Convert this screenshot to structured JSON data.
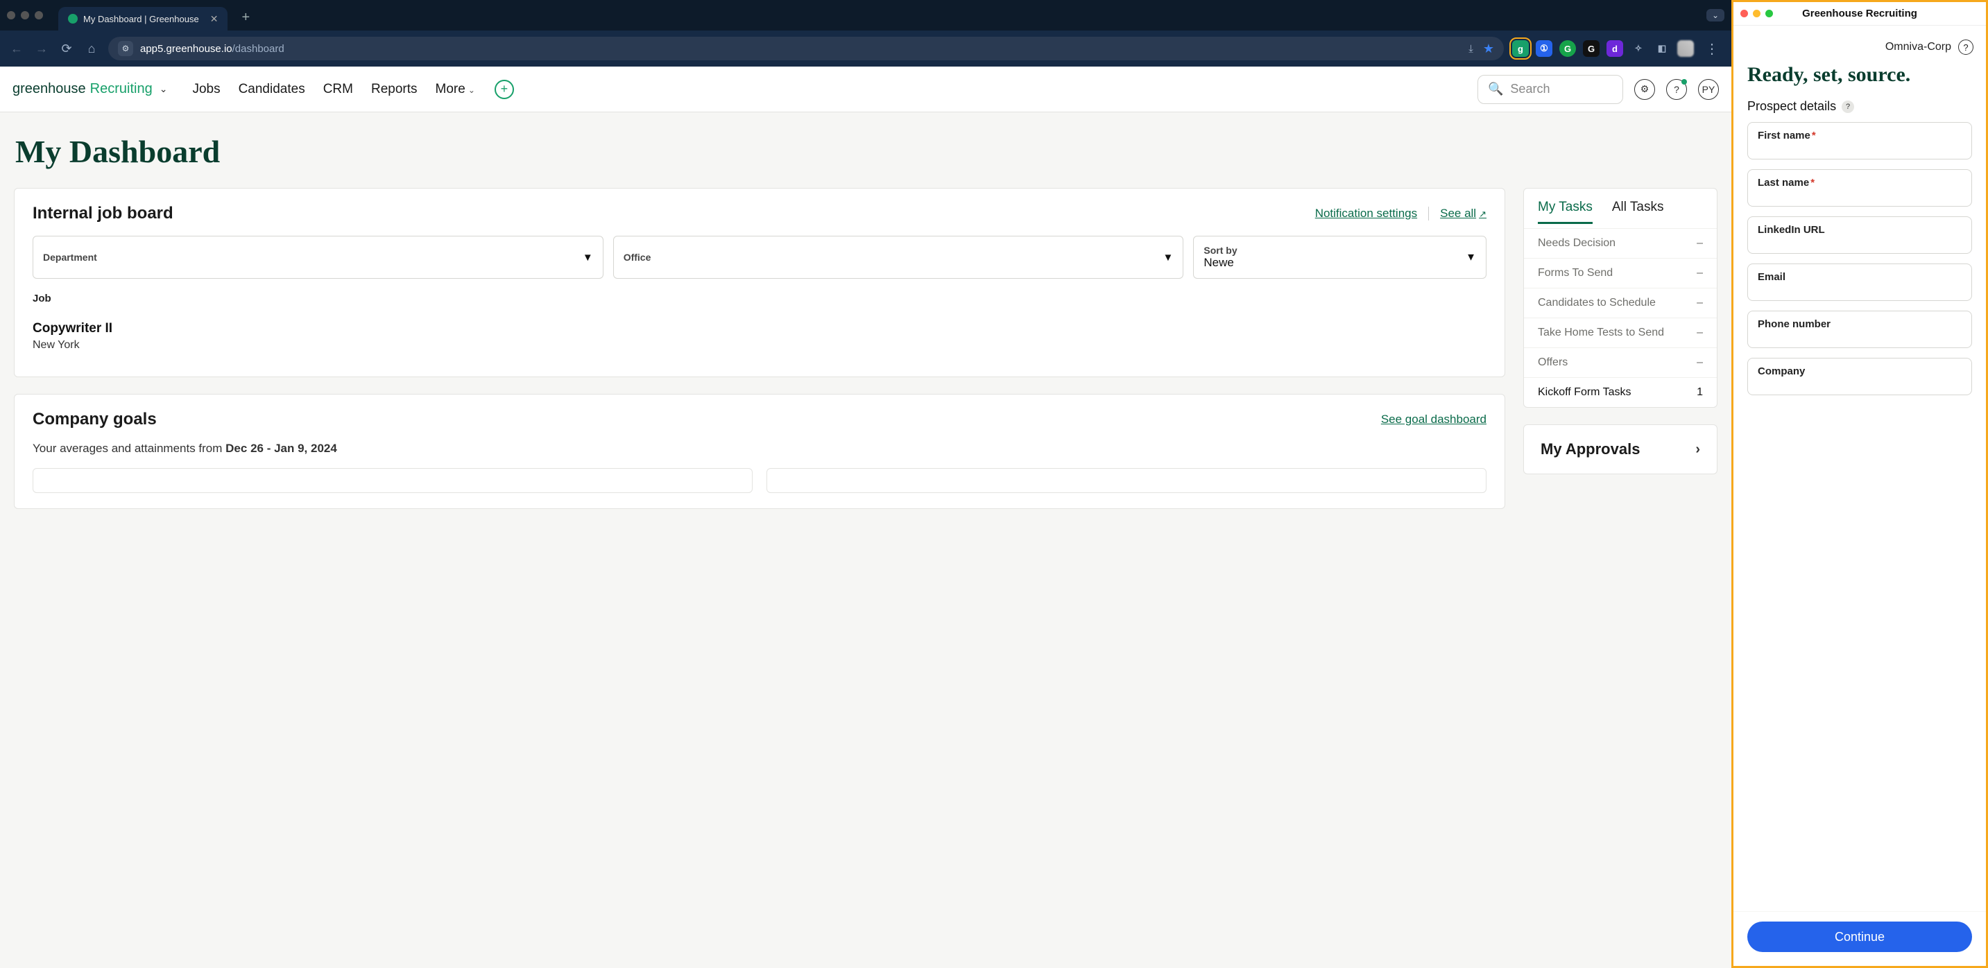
{
  "browser": {
    "tab_title": "My Dashboard | Greenhouse",
    "url_host": "app5.greenhouse.io",
    "url_path": "/dashboard"
  },
  "header": {
    "brand_left": "greenhouse",
    "brand_right": "Recruiting",
    "nav": {
      "jobs": "Jobs",
      "candidates": "Candidates",
      "crm": "CRM",
      "reports": "Reports",
      "more": "More"
    },
    "search_placeholder": "Search",
    "avatar_initials": "PY"
  },
  "page": {
    "title": "My Dashboard"
  },
  "job_board": {
    "title": "Internal job board",
    "notification_link": "Notification settings",
    "see_all_link": "See all",
    "filters": {
      "department_label": "Department",
      "office_label": "Office",
      "sort_label": "Sort by",
      "sort_value": "Newe"
    },
    "col_label": "Job",
    "jobs": [
      {
        "title": "Copywriter II",
        "location": "New York"
      }
    ]
  },
  "goals": {
    "title": "Company goals",
    "link": "See goal dashboard",
    "subtitle_prefix": "Your averages and attainments from ",
    "subtitle_range": "Dec 26 - Jan 9, 2024"
  },
  "tasks": {
    "tab_my": "My Tasks",
    "tab_all": "All Tasks",
    "items": [
      {
        "label": "Needs Decision",
        "count": "–",
        "active": false
      },
      {
        "label": "Forms To Send",
        "count": "–",
        "active": false
      },
      {
        "label": "Candidates to Schedule",
        "count": "–",
        "active": false
      },
      {
        "label": "Take Home Tests to Send",
        "count": "–",
        "active": false
      },
      {
        "label": "Offers",
        "count": "–",
        "active": false
      },
      {
        "label": "Kickoff Form Tasks",
        "count": "1",
        "active": true
      }
    ]
  },
  "approvals": {
    "title": "My Approvals"
  },
  "extension": {
    "window_title": "Greenhouse Recruiting",
    "org": "Omniva-Corp",
    "headline": "Ready, set, source.",
    "section": "Prospect details",
    "fields": {
      "first_name": "First name",
      "last_name": "Last name",
      "linkedin": "LinkedIn URL",
      "email": "Email",
      "phone": "Phone number",
      "company": "Company"
    },
    "continue": "Continue"
  }
}
